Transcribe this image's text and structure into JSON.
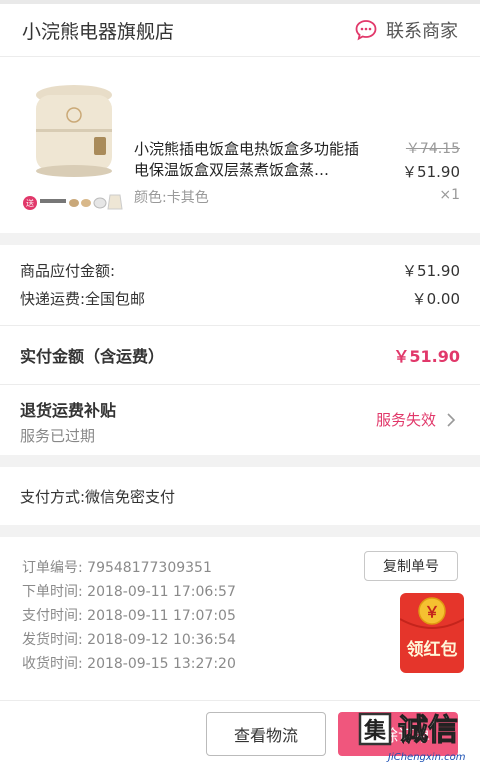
{
  "store": {
    "name": "小浣熊电器旗舰店",
    "contact_label": "联系商家"
  },
  "product": {
    "title": "小浣熊插电饭盒电热饭盒多功能插电保温饭盒双层蒸煮饭盒蒸…",
    "variant": "颜色:卡其色",
    "original_price": "￥74.15",
    "price": "￥51.90",
    "quantity": "×1",
    "gift_badge": "送"
  },
  "summary": {
    "goods_label": "商品应付金额:",
    "goods_value": "￥51.90",
    "shipping_label": "快递运费:全国包邮",
    "shipping_value": "￥0.00",
    "actual_label": "实付金额（含运费）",
    "actual_value": "￥51.90"
  },
  "subsidy": {
    "title": "退货运费补贴",
    "subtitle": "服务已过期",
    "status": "服务失效"
  },
  "payment": {
    "method": "支付方式:微信免密支付"
  },
  "order_info": {
    "order_no": "订单编号: 79548177309351",
    "created": "下单时间: 2018-09-11  17:06:57",
    "paid": "支付时间: 2018-09-11  17:07:05",
    "shipped": "发货时间: 2018-09-12  10:36:54",
    "received": "收货时间: 2018-09-15  13:27:20",
    "copy_label": "复制单号"
  },
  "red_packet": {
    "symbol": "￥",
    "label": "领红包"
  },
  "bottom": {
    "logistics_label": "查看物流",
    "confirm_label": "删除订单"
  },
  "watermark": {
    "char_box": "集",
    "text": "诚信",
    "url": "JiChengxin.com"
  },
  "colors": {
    "accent": "#e1386a",
    "button_pink": "#f0567d",
    "red_packet": "#e5352b"
  }
}
